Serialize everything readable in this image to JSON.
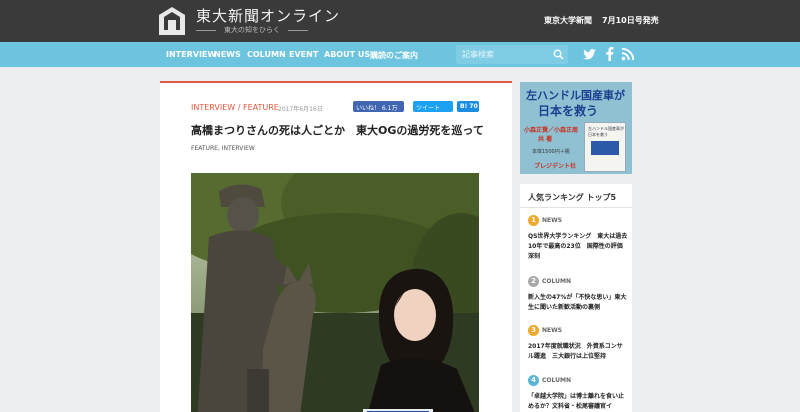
{
  "header": {
    "site_title": "東大新聞オンライン",
    "site_tagline": "東大の知をひらく",
    "publisher": "東京大学新聞",
    "issue": "7月10日号発売"
  },
  "nav": {
    "items": [
      "INTERVIEW",
      "NEWS",
      "COLUMN",
      "EVENT",
      "ABOUT US",
      "購読のご案内"
    ],
    "search_placeholder": "記事検索"
  },
  "article": {
    "category": "INTERVIEW / FEATURE",
    "date": "2017年6月16日",
    "like_label": "いいね！ 6.1万",
    "tweet_label": "ツイート",
    "hatena_label": "B! 70",
    "title": "高橋まつりさんの死は人ごとか　東大OGの過労死を巡って",
    "tags": "FEATURE, INTERVIEW"
  },
  "ad": {
    "headline_1": "左ハンドル国産車が",
    "headline_2": "日本を救う",
    "author": "小森正賢／小森正周",
    "author_2": "共 著",
    "price": "本体1500円＋税",
    "publisher": "プレジデント社",
    "book_title": "左ハンドル国産車が日本を救う"
  },
  "ranking": {
    "heading": "人気ランキング トップ5",
    "items": [
      {
        "num": "1",
        "category": "NEWS",
        "text": "QS世界大学ランキング　東大は過去10年で最高の23位　国際性の評価深刻"
      },
      {
        "num": "2",
        "category": "COLUMN",
        "text": "新入生の47%が「不快な思い」東大生に聞いた新歓活動の裏側"
      },
      {
        "num": "3",
        "category": "NEWS",
        "text": "2017年度就職状況　外資系コンサル躍進　三大銀行は上位堅持"
      },
      {
        "num": "4",
        "category": "COLUMN",
        "text": "「卓越大学院」は博士離れを食い止めるか？文科省・松尾審議官イ"
      }
    ]
  },
  "colors": {
    "header_bg": "#3a3a3a",
    "nav_bg": "#6cc4df",
    "accent": "#e2593f",
    "rank_1": "#f0a92b",
    "rank_2": "#a9a9a9",
    "rank_3": "#f0a92b",
    "rank_4": "#5bb5d6"
  }
}
